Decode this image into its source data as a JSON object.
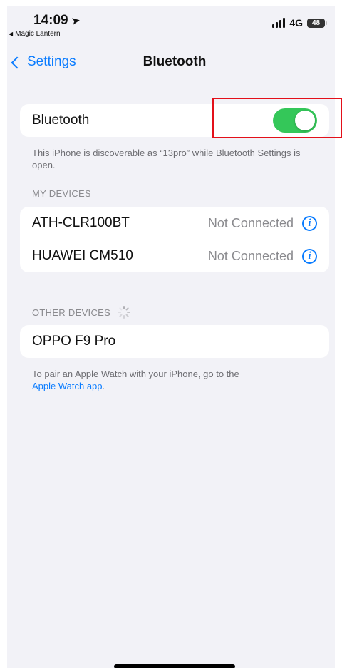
{
  "status_bar": {
    "time": "14:09",
    "back_app": "Magic Lantern",
    "network": "4G",
    "battery": "48"
  },
  "nav": {
    "back_label": "Settings",
    "title": "Bluetooth"
  },
  "bluetooth": {
    "label": "Bluetooth",
    "enabled": true,
    "discoverable_note": "This iPhone is discoverable as “13pro” while Bluetooth Settings is open."
  },
  "my_devices": {
    "header": "MY DEVICES",
    "items": [
      {
        "name": "ATH-CLR100BT",
        "status": "Not Connected"
      },
      {
        "name": "HUAWEI CM510",
        "status": "Not Connected"
      }
    ]
  },
  "other_devices": {
    "header": "OTHER DEVICES",
    "items": [
      {
        "name": "OPPO F9 Pro"
      }
    ]
  },
  "footer": {
    "text": "To pair an Apple Watch with your iPhone, go to the",
    "link": "Apple Watch app",
    "suffix": "."
  },
  "colors": {
    "accent": "#0a7cff",
    "toggle_on": "#34c759",
    "highlight": "#e3101a"
  },
  "icons": [
    "location-arrow-icon",
    "signal-bars-icon",
    "battery-icon",
    "chevron-left-icon",
    "info-icon",
    "spinner-icon"
  ]
}
